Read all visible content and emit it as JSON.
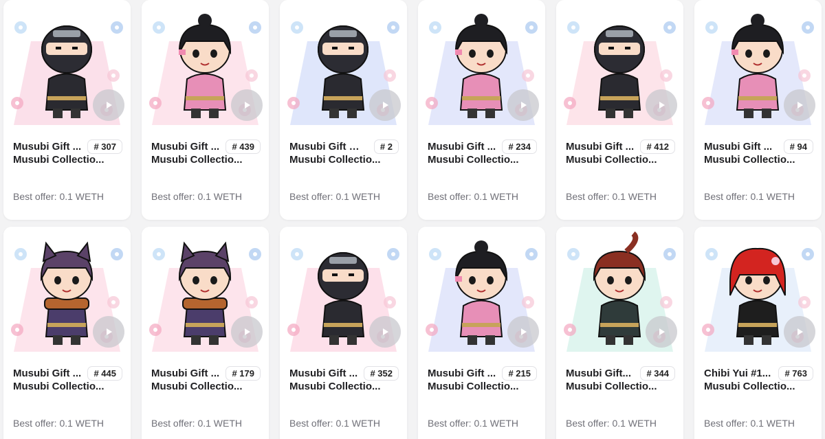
{
  "items": [
    {
      "title": "Musubi Gift ...",
      "number": "# 307",
      "collection": "Musubi Collectio...",
      "offer": "Best offer: 0.1 WETH",
      "character": "ninja-masked",
      "bg": "#fbe0ea"
    },
    {
      "title": "Musubi Gift ...",
      "number": "# 439",
      "collection": "Musubi Collectio...",
      "offer": "Best offer: 0.1 WETH",
      "character": "girl-pink",
      "bg": "#fde4ec"
    },
    {
      "title": "Musubi Gift #1...",
      "number": "# 2",
      "collection": "Musubi Collectio...",
      "offer": "Best offer: 0.1 WETH",
      "character": "ninja-masked",
      "bg": "#dfe6fb"
    },
    {
      "title": "Musubi Gift ...",
      "number": "# 234",
      "collection": "Musubi Collectio...",
      "offer": "Best offer: 0.1 WETH",
      "character": "girl-pink",
      "bg": "#e3e7fb"
    },
    {
      "title": "Musubi Gift ...",
      "number": "# 412",
      "collection": "Musubi Collectio...",
      "offer": "Best offer: 0.1 WETH",
      "character": "ninja-masked",
      "bg": "#fde4ea"
    },
    {
      "title": "Musubi Gift ...",
      "number": "# 94",
      "collection": "Musubi Collectio...",
      "offer": "Best offer: 0.1 WETH",
      "character": "girl-pink",
      "bg": "#e4e8fb"
    },
    {
      "title": "Musubi Gift ...",
      "number": "# 445",
      "collection": "Musubi Collectio...",
      "offer": "Best offer: 0.1 WETH",
      "character": "catboy",
      "bg": "#fde4ec"
    },
    {
      "title": "Musubi Gift ...",
      "number": "# 179",
      "collection": "Musubi Collectio...",
      "offer": "Best offer: 0.1 WETH",
      "character": "catboy",
      "bg": "#fde4ec"
    },
    {
      "title": "Musubi Gift ...",
      "number": "# 352",
      "collection": "Musubi Collectio...",
      "offer": "Best offer: 0.1 WETH",
      "character": "ninja-masked",
      "bg": "#fde0ea"
    },
    {
      "title": "Musubi Gift ...",
      "number": "# 215",
      "collection": "Musubi Collectio...",
      "offer": "Best offer: 0.1 WETH",
      "character": "girl-pink",
      "bg": "#e3e7fb"
    },
    {
      "title": "Musubi Gift...",
      "number": "# 344",
      "collection": "Musubi Collectio...",
      "offer": "Best offer: 0.1 WETH",
      "character": "redhair",
      "bg": "#dff5ef"
    },
    {
      "title": "Chibi Yui #1...",
      "number": "# 763",
      "collection": "Musubi Collectio...",
      "offer": "Best offer: 0.1 WETH",
      "character": "yui",
      "bg": "#e8f0fb"
    }
  ]
}
